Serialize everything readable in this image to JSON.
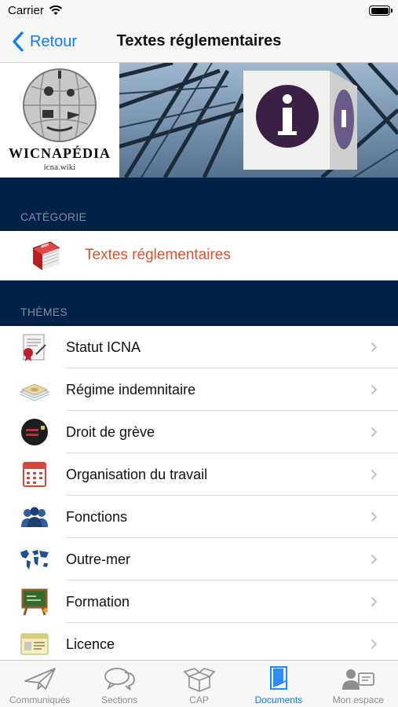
{
  "status_bar": {
    "carrier": "Carrier"
  },
  "nav": {
    "back_label": "Retour",
    "title": "Textes réglementaires"
  },
  "banner": {
    "brand": "WICNAPÉDIA",
    "url": "icna.wiki"
  },
  "category_section": {
    "header": "CATÉGORIE",
    "item": {
      "label": "Textes réglementaires",
      "icon": "red-book-icon"
    }
  },
  "themes_section": {
    "header": "THÈMES",
    "items": [
      {
        "label": "Statut ICNA",
        "icon": "certificate-icon"
      },
      {
        "label": "Régime indemnitaire",
        "icon": "banknotes-icon"
      },
      {
        "label": "Droit de grève",
        "icon": "strike-icon"
      },
      {
        "label": "Organisation du travail",
        "icon": "calendar-icon"
      },
      {
        "label": "Fonctions",
        "icon": "people-icon"
      },
      {
        "label": "Outre-mer",
        "icon": "world-map-icon"
      },
      {
        "label": "Formation",
        "icon": "chalkboard-icon"
      },
      {
        "label": "Licence",
        "icon": "license-card-icon"
      }
    ]
  },
  "tab_bar": {
    "tabs": [
      {
        "label": "Communiqués",
        "icon": "paper-plane-icon",
        "active": false
      },
      {
        "label": "Sections",
        "icon": "speech-bubbles-icon",
        "active": false
      },
      {
        "label": "CAP",
        "icon": "open-box-icon",
        "active": false
      },
      {
        "label": "Documents",
        "icon": "document-icon",
        "active": true
      },
      {
        "label": "Mon espace",
        "icon": "user-card-icon",
        "active": false
      }
    ]
  },
  "colors": {
    "accent": "#0a7aff",
    "section_background": "#002147",
    "category_label": "#e0502b"
  }
}
